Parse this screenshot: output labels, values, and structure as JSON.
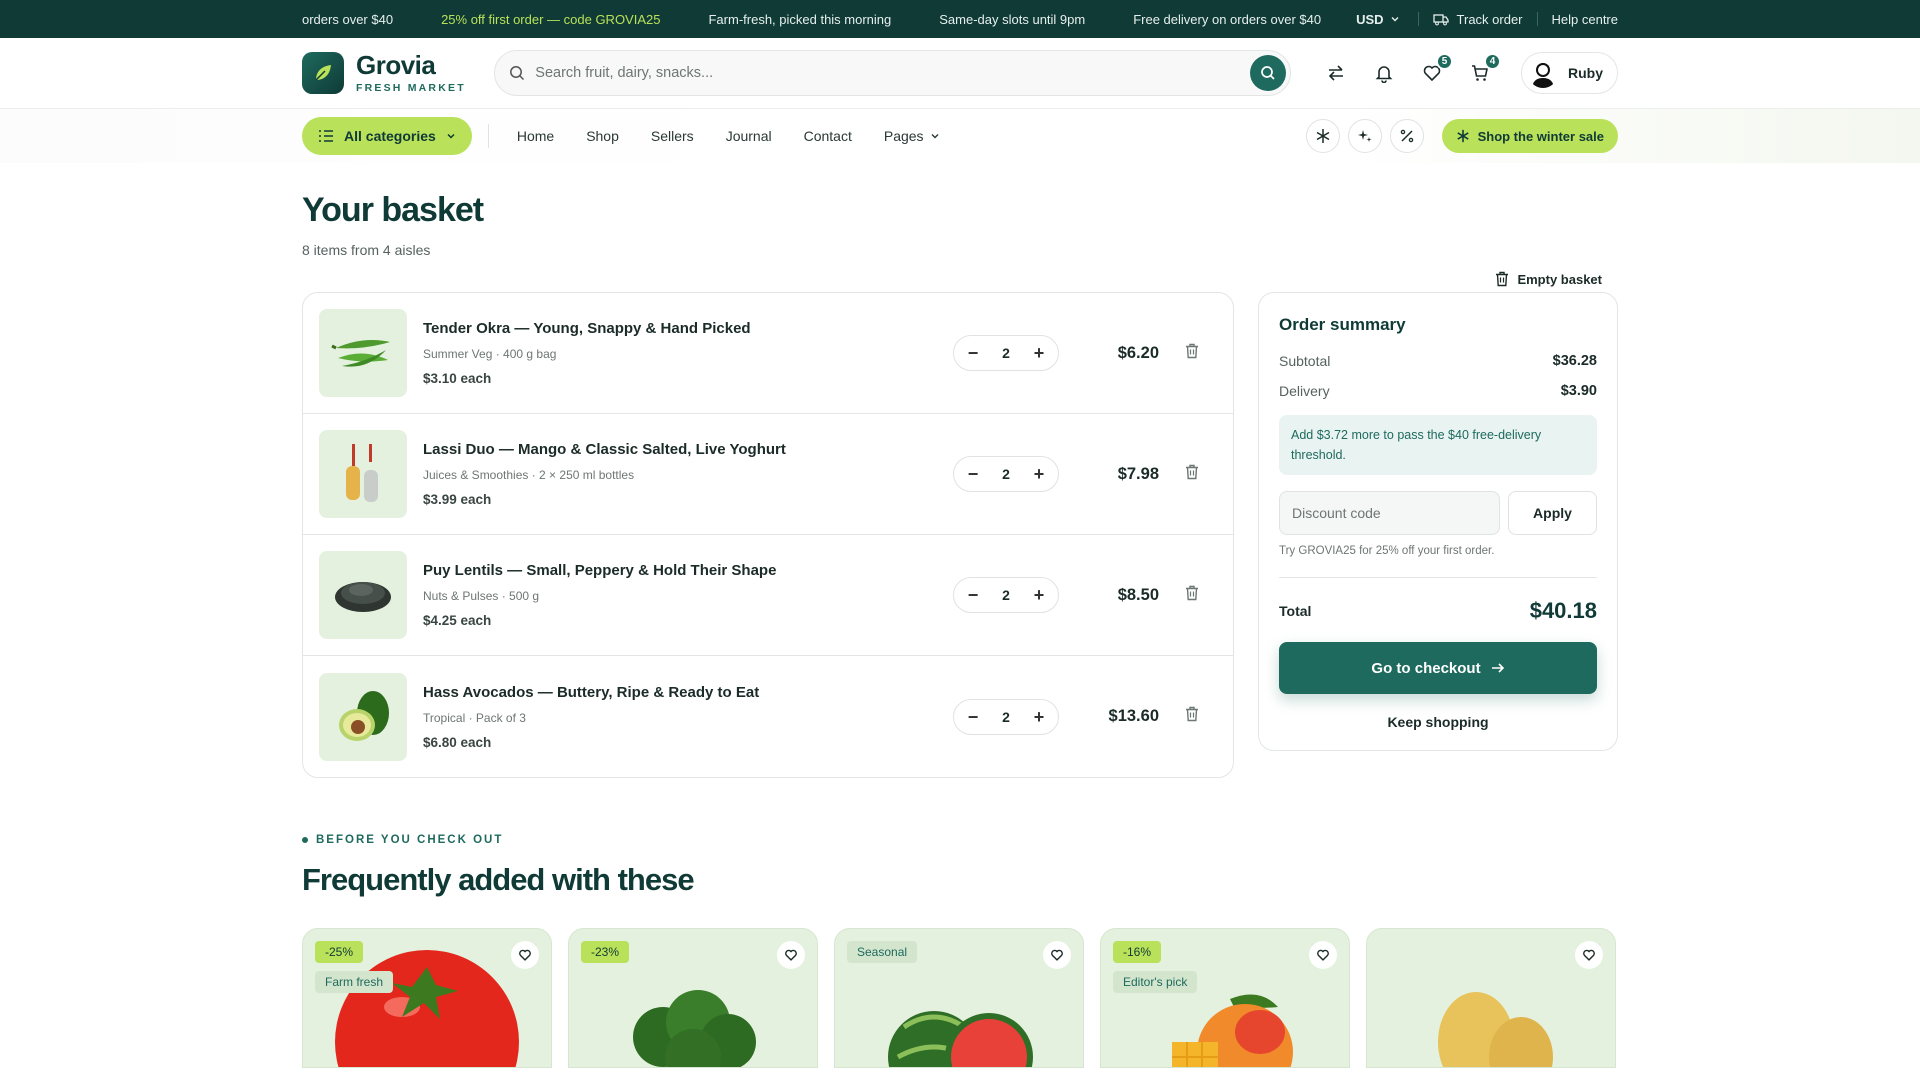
{
  "topbar": {
    "ticker": [
      "orders over $40",
      "25% off first order — code GROVIA25",
      "Farm-fresh, picked this morning",
      "Same-day slots until 9pm",
      "Free delivery on orders over $40"
    ],
    "currency": "USD",
    "track_order": "Track order",
    "help": "Help centre"
  },
  "header": {
    "brand": "Grovia",
    "brand_sub": "FRESH MARKET",
    "search_placeholder": "Search fruit, dairy, snacks...",
    "wishlist_count": "5",
    "cart_count": "4",
    "user_name": "Ruby"
  },
  "nav": {
    "categories": "All categories",
    "links": [
      "Home",
      "Shop",
      "Sellers",
      "Journal",
      "Contact",
      "Pages"
    ],
    "sale": "Shop the winter sale"
  },
  "page": {
    "title": "Your basket",
    "subtitle": "8 items from 4 aisles",
    "empty": "Empty basket"
  },
  "items": [
    {
      "name": "Tender Okra — Young, Snappy & Hand Picked",
      "meta": "Summer Veg · 400 g bag",
      "unit": "$3.10 each",
      "qty": "2",
      "price": "$6.20"
    },
    {
      "name": "Lassi Duo — Mango & Classic Salted, Live Yoghurt",
      "meta": "Juices & Smoothies · 2 × 250 ml bottles",
      "unit": "$3.99 each",
      "qty": "2",
      "price": "$7.98"
    },
    {
      "name": "Puy Lentils — Small, Peppery & Hold Their Shape",
      "meta": "Nuts & Pulses · 500 g",
      "unit": "$4.25 each",
      "qty": "2",
      "price": "$8.50"
    },
    {
      "name": "Hass Avocados — Buttery, Ripe & Ready to Eat",
      "meta": "Tropical · Pack of 3",
      "unit": "$6.80 each",
      "qty": "2",
      "price": "$13.60"
    }
  ],
  "summary": {
    "title": "Order summary",
    "subtotal_label": "Subtotal",
    "subtotal": "$36.28",
    "delivery_label": "Delivery",
    "delivery": "$3.90",
    "note": "Add $3.72 more to pass the $40 free-delivery threshold.",
    "discount_placeholder": "Discount code",
    "apply": "Apply",
    "hint": "Try GROVIA25 for 25% off your first order.",
    "total_label": "Total",
    "total": "$40.18",
    "checkout": "Go to checkout",
    "keep": "Keep shopping"
  },
  "recs": {
    "eyebrow": "BEFORE YOU CHECK OUT",
    "title": "Frequently added with these",
    "cards": [
      {
        "tag": "-25%",
        "tag2": "Farm fresh"
      },
      {
        "tag": "-23%",
        "tag2": ""
      },
      {
        "tag": "Seasonal",
        "tag2": ""
      },
      {
        "tag": "-16%",
        "tag2": "Editor's pick"
      },
      {
        "tag": "",
        "tag2": ""
      }
    ]
  },
  "colors": {
    "brand": "#0f3a36",
    "accent": "#1e6a5e",
    "lime": "#b9e15a"
  }
}
